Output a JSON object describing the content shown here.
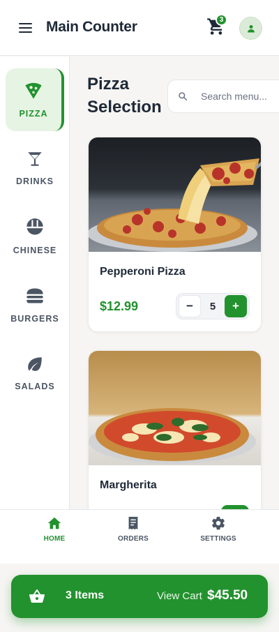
{
  "header": {
    "title": "Main Counter",
    "cart_count": "3"
  },
  "sidebar": {
    "items": [
      {
        "label": "PIZZA",
        "icon": "pizza-icon",
        "active": true
      },
      {
        "label": "DRINKS",
        "icon": "cocktail-icon",
        "active": false
      },
      {
        "label": "CHINESE",
        "icon": "ramen-bowl-icon",
        "active": false
      },
      {
        "label": "BURGERS",
        "icon": "burger-icon",
        "active": false
      },
      {
        "label": "SALADS",
        "icon": "leaf-icon",
        "active": false
      }
    ]
  },
  "main": {
    "section_title": "Pizza Selection",
    "search": {
      "placeholder": "Search menu..."
    },
    "products": [
      {
        "name": "Pepperoni Pizza",
        "price": "$12.99",
        "quantity": "5",
        "image": "pepperoni-pizza-photo"
      },
      {
        "name": "Margherita",
        "price": "",
        "quantity": "",
        "image": "margherita-pizza-photo"
      }
    ]
  },
  "bottom_nav": {
    "items": [
      {
        "label": "HOME",
        "icon": "home-icon",
        "active": true
      },
      {
        "label": "ORDERS",
        "icon": "receipt-icon",
        "active": false
      },
      {
        "label": "SETTINGS",
        "icon": "gear-icon",
        "active": false
      }
    ]
  },
  "cart_bar": {
    "items_label": "3 Items",
    "view_label": "View Cart",
    "total": "$45.50"
  },
  "colors": {
    "accent": "#22922e",
    "accent_light": "#e6f4e3",
    "text_dark": "#1f2937",
    "text_muted": "#4b5563"
  }
}
